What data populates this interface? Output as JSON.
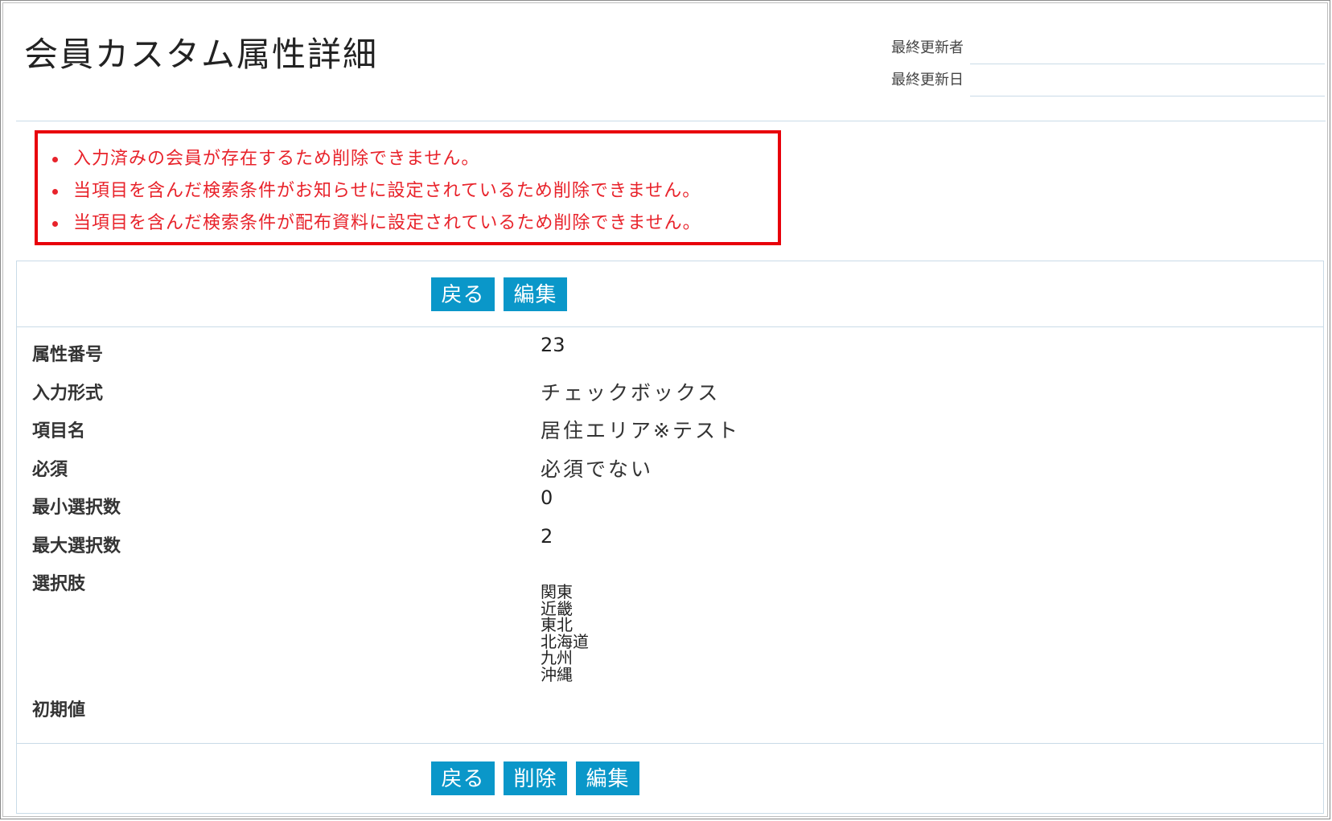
{
  "page": {
    "title": "会員カスタム属性詳細"
  },
  "meta": {
    "last_updated_by_label": "最終更新者",
    "last_updated_by_value": "",
    "last_updated_date_label": "最終更新日",
    "last_updated_date_value": ""
  },
  "errors": [
    "入力済みの会員が存在するため削除できません。",
    "当項目を含んだ検索条件がお知らせに設定されているため削除できません。",
    "当項目を含んだ検索条件が配布資料に設定されているため削除できません。"
  ],
  "buttons": {
    "back": "戻る",
    "edit": "編集",
    "delete": "削除"
  },
  "fields": {
    "attr_no": {
      "label": "属性番号",
      "value": "23"
    },
    "input_type": {
      "label": "入力形式",
      "value": "チェックボックス"
    },
    "item_name": {
      "label": "項目名",
      "value": "居住エリア※テスト"
    },
    "required": {
      "label": "必須",
      "value": "必須でない"
    },
    "min_select": {
      "label": "最小選択数",
      "value": "0"
    },
    "max_select": {
      "label": "最大選択数",
      "value": "2"
    },
    "options": {
      "label": "選択肢",
      "values": [
        "関東",
        "近畿",
        "東北",
        "北海道",
        "九州",
        "沖縄"
      ]
    },
    "initial": {
      "label": "初期値",
      "value": ""
    }
  },
  "colors": {
    "button_bg": "#0a97c9",
    "error_border": "#e8000b",
    "error_text": "#e8232b",
    "rule": "#c9dbe7"
  }
}
